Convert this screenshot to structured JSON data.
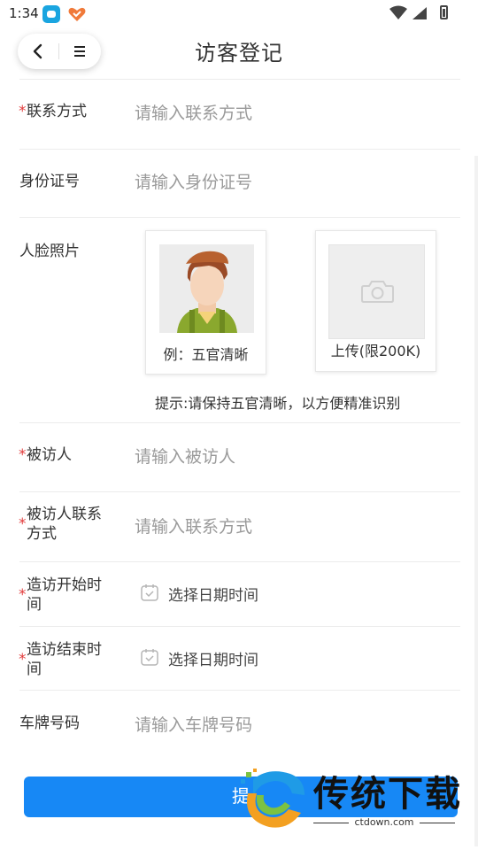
{
  "status_bar": {
    "time": "1:34"
  },
  "header": {
    "title": "访客登记"
  },
  "form": {
    "required_mark": "*",
    "phone": {
      "label": "联系方式",
      "placeholder": "请输入联系方式"
    },
    "id_number": {
      "label": "身份证号",
      "placeholder": "请输入身份证号"
    },
    "face_photo": {
      "label": "人脸照片",
      "example_caption": "例：五官清晰",
      "upload_caption": "上传(限200K)",
      "hint": "提示:请保持五官清晰，以方便精准识别"
    },
    "visitee": {
      "label": "被访人",
      "placeholder": "请输入被访人"
    },
    "visitee_phone": {
      "label_line1": "被访人联系",
      "label_line2": "方式",
      "placeholder": "请输入联系方式"
    },
    "visit_start": {
      "label_line1": "造访开始时",
      "label_line2": "间",
      "value": "选择日期时间"
    },
    "visit_end": {
      "label_line1": "造访结束时",
      "label_line2": "间",
      "value": "选择日期时间"
    },
    "plate_number": {
      "label": "车牌号码",
      "placeholder": "请输入车牌号码"
    }
  },
  "submit": {
    "label": "提"
  },
  "watermark": {
    "title": "传统下载",
    "url": "ctdown.com"
  },
  "colors": {
    "primary": "#1788f5",
    "required": "#e23b3b",
    "placeholder": "#9a9a9a"
  },
  "icons": [
    "back-icon",
    "menu-icon",
    "calendar-icon",
    "camera-icon",
    "wifi-icon",
    "signal-icon",
    "battery-icon"
  ]
}
